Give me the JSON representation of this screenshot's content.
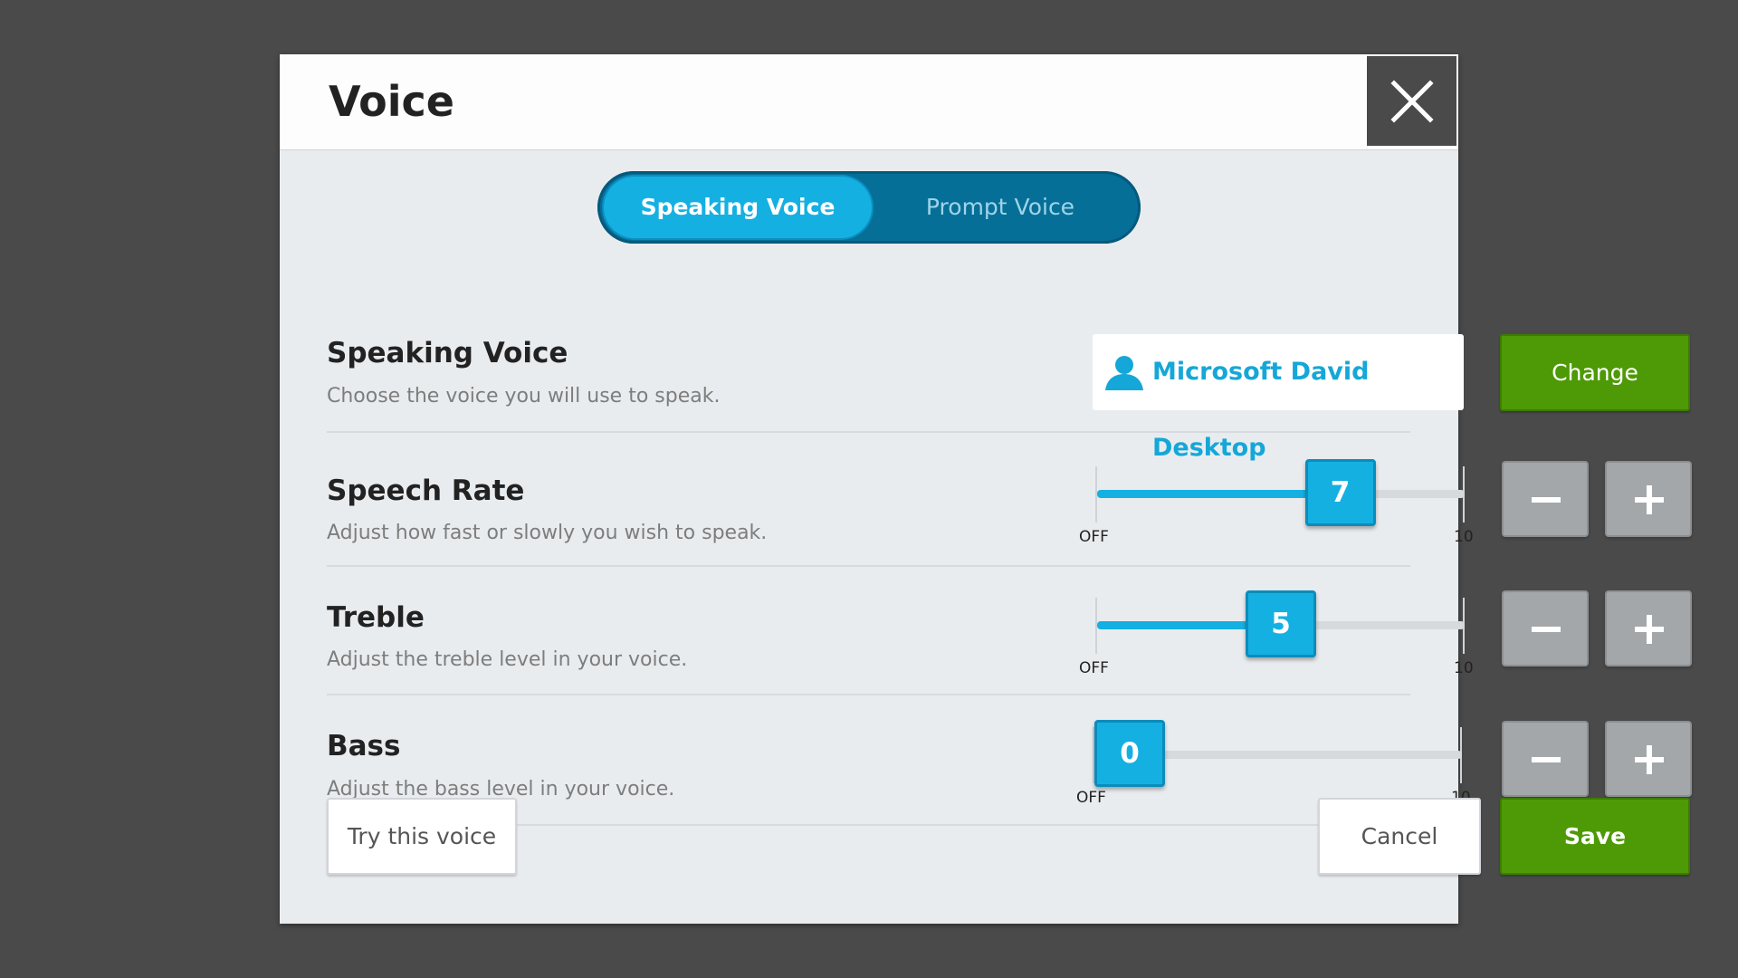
{
  "dialog": {
    "title": "Voice",
    "close_icon": "close-icon"
  },
  "tabs": [
    {
      "label": "Speaking Voice",
      "active": true
    },
    {
      "label": "Prompt Voice",
      "active": false
    }
  ],
  "speaking_voice": {
    "label": "Speaking Voice",
    "description": "Choose the voice you will use to speak.",
    "selected_voice": "Microsoft David Desktop",
    "voice_icon": "person-icon",
    "change_label": "Change"
  },
  "speech_rate": {
    "label": "Speech Rate",
    "description": "Adjust how fast or slowly you wish to speak.",
    "value": 7,
    "min_label": "OFF",
    "max_label": "10"
  },
  "treble": {
    "label": "Treble",
    "description": "Adjust the treble level in your voice.",
    "value": 5,
    "min_label": "OFF",
    "max_label": "10"
  },
  "bass": {
    "label": "Bass",
    "description": "Adjust the bass level in your voice.",
    "value": 0,
    "min_label": "OFF",
    "max_label": "10"
  },
  "footer": {
    "try_label": "Try this voice",
    "cancel_label": "Cancel",
    "save_label": "Save"
  },
  "colors": {
    "accent_blue": "#15b0e2",
    "toggle_dark": "#066f98",
    "green": "#4e9a06",
    "stepper_gray": "#a4a7aa",
    "backdrop": "#4a4a4a"
  }
}
